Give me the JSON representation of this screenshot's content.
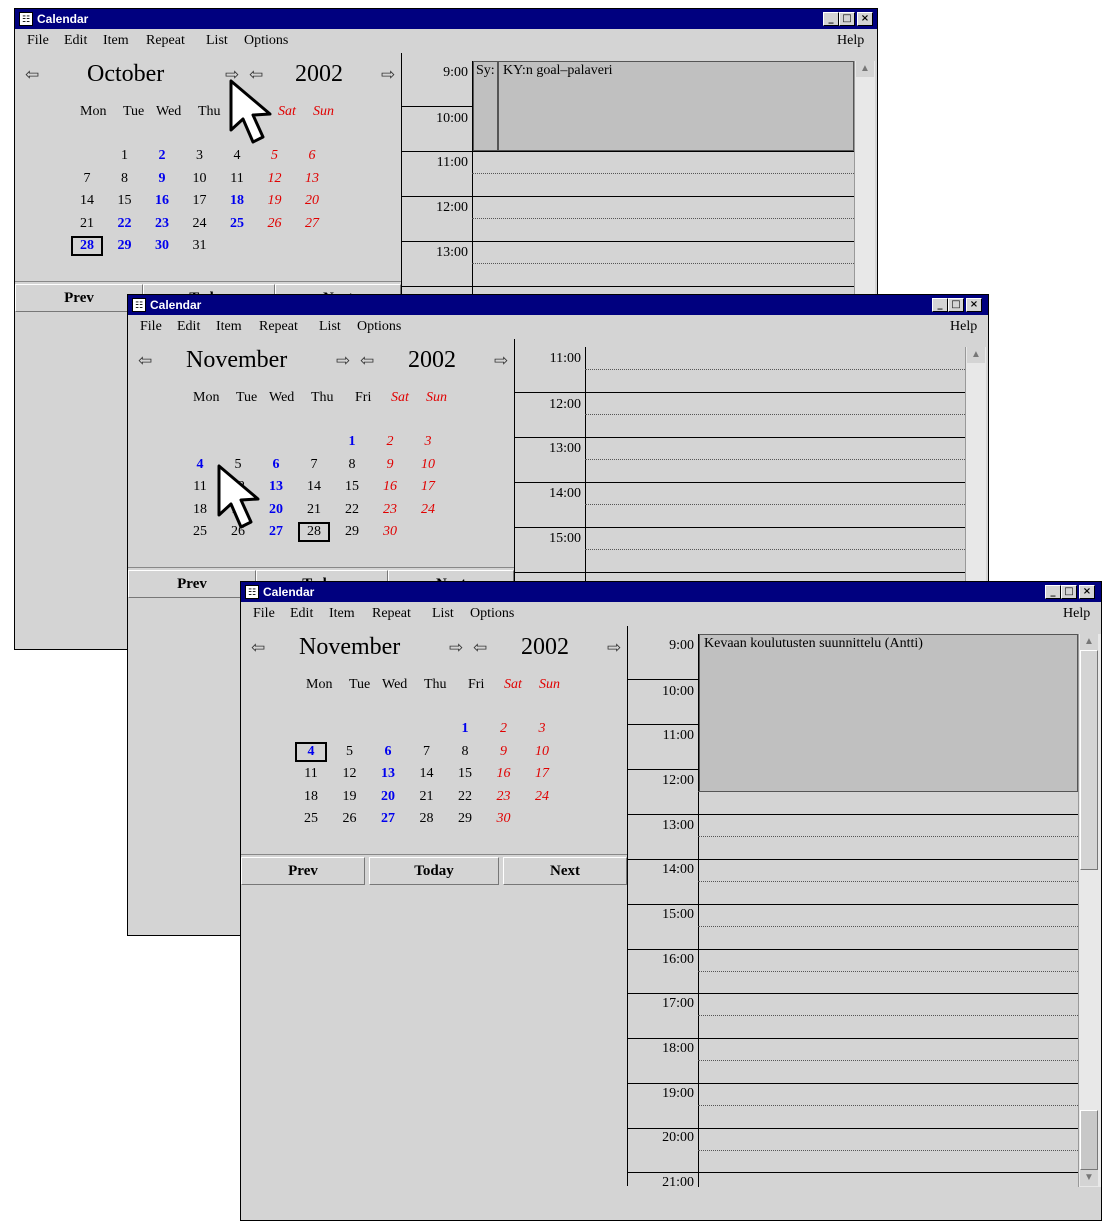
{
  "title": "Calendar",
  "window_controls": {
    "minimize": "_",
    "maximize": "□",
    "close": "×"
  },
  "menu": {
    "items": [
      "File",
      "Edit",
      "Item",
      "Repeat",
      "List",
      "Options"
    ],
    "help": "Help"
  },
  "weekdays": [
    "Mon",
    "Tue",
    "Wed",
    "Thu",
    "Fri",
    "Sat",
    "Sun"
  ],
  "nav_arrows": {
    "prev": "⇦",
    "next": "⇨"
  },
  "buttons": {
    "prev": "Prev",
    "today": "Today",
    "next": "Next"
  },
  "win1": {
    "month": "October",
    "year": "2002",
    "weeks": [
      [
        "",
        "1",
        "2",
        "3",
        "4",
        "5",
        "6"
      ],
      [
        "7",
        "8",
        "9",
        "10",
        "11",
        "12",
        "13"
      ],
      [
        "14",
        "15",
        "16",
        "17",
        "18",
        "19",
        "20"
      ],
      [
        "21",
        "22",
        "23",
        "24",
        "25",
        "26",
        "27"
      ],
      [
        "28",
        "29",
        "30",
        "31",
        "",
        "",
        ""
      ]
    ],
    "bold_days": [
      "2",
      "9",
      "16",
      "18",
      "22",
      "23",
      "25",
      "28",
      "29",
      "30"
    ],
    "selected_day": "28",
    "times": [
      "9:00",
      "10:00",
      "11:00",
      "12:00",
      "13:00"
    ],
    "events": [
      {
        "label": "Sy:"
      },
      {
        "label": "KY:n goal–palaveri"
      }
    ]
  },
  "win2": {
    "month": "November",
    "year": "2002",
    "weeks": [
      [
        "",
        "",
        "",
        "",
        "1",
        "2",
        "3"
      ],
      [
        "4",
        "5",
        "6",
        "7",
        "8",
        "9",
        "10"
      ],
      [
        "11",
        "12",
        "13",
        "14",
        "15",
        "16",
        "17"
      ],
      [
        "18",
        "19",
        "20",
        "21",
        "22",
        "23",
        "24"
      ],
      [
        "25",
        "26",
        "27",
        "28",
        "29",
        "30",
        ""
      ]
    ],
    "bold_days": [
      "1",
      "4",
      "6",
      "13",
      "20",
      "27"
    ],
    "selected_day": "28",
    "times": [
      "11:00",
      "12:00",
      "13:00",
      "14:00",
      "15:00"
    ]
  },
  "win3": {
    "month": "November",
    "year": "2002",
    "weeks": [
      [
        "",
        "",
        "",
        "",
        "1",
        "2",
        "3"
      ],
      [
        "4",
        "5",
        "6",
        "7",
        "8",
        "9",
        "10"
      ],
      [
        "11",
        "12",
        "13",
        "14",
        "15",
        "16",
        "17"
      ],
      [
        "18",
        "19",
        "20",
        "21",
        "22",
        "23",
        "24"
      ],
      [
        "25",
        "26",
        "27",
        "28",
        "29",
        "30",
        ""
      ]
    ],
    "bold_days": [
      "1",
      "4",
      "6",
      "13",
      "20",
      "27"
    ],
    "selected_day": "4",
    "times": [
      "9:00",
      "10:00",
      "11:00",
      "12:00",
      "13:00",
      "14:00",
      "15:00",
      "16:00",
      "17:00",
      "18:00",
      "19:00",
      "20:00",
      "21:00"
    ],
    "events": [
      {
        "label": "Kevaan koulutusten suunnittelu (Antti)"
      }
    ]
  }
}
